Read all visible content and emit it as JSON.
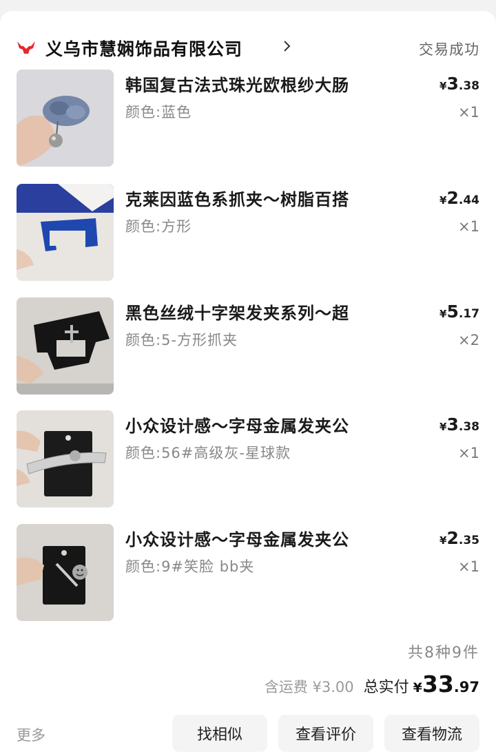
{
  "shop": {
    "logo_icon": "red-bull-logo-icon",
    "name": "义乌市慧娴饰品有限公司",
    "chevron_icon": "chevron-right-icon",
    "status": "交易成功"
  },
  "items": [
    {
      "title": "韩国复古法式珠光欧根纱大肠",
      "variant": "颜色:蓝色",
      "price_int": "3",
      "price_dec": ".38",
      "currency": "¥",
      "qty": "×1",
      "thumb": "blue-scrunchie-pearl"
    },
    {
      "title": "克莱因蓝色系抓夹～树脂百搭",
      "variant": "颜色:方形",
      "price_int": "2",
      "price_dec": ".44",
      "currency": "¥",
      "qty": "×1",
      "thumb": "blue-claw-clip"
    },
    {
      "title": "黑色丝绒十字架发夹系列～超",
      "variant": "颜色:5-方形抓夹",
      "price_int": "5",
      "price_dec": ".17",
      "currency": "¥",
      "qty": "×2",
      "thumb": "black-velvet-cross-clip"
    },
    {
      "title": "小众设计感～字母金属发夹公",
      "variant": "颜色:56#高级灰-星球款",
      "price_int": "3",
      "price_dec": ".38",
      "currency": "¥",
      "qty": "×1",
      "thumb": "grey-planet-hair-clip"
    },
    {
      "title": "小众设计感～字母金属发夹公",
      "variant": "颜色:9#笑脸 bb夹",
      "price_int": "2",
      "price_dec": ".35",
      "currency": "¥",
      "qty": "×1",
      "thumb": "smiley-bb-clip"
    }
  ],
  "summary": {
    "count": "共8种9件",
    "shipping": "含运费 ¥3.00",
    "total_label": "总实付",
    "total_currency": "¥",
    "total_int": "33",
    "total_dec": ".97"
  },
  "footer": {
    "more": "更多",
    "btn_similar": "找相似",
    "btn_review": "查看评价",
    "btn_logistics": "查看物流"
  },
  "colors": {
    "brand_red": "#e8262d",
    "background": "#f2f2f2",
    "button_bg": "#f4f4f4"
  }
}
